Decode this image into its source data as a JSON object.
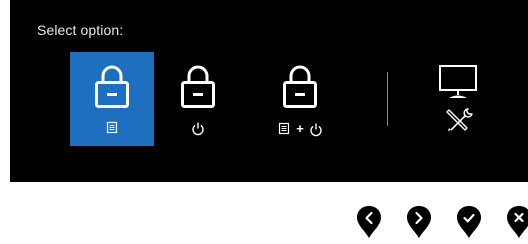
{
  "osd": {
    "prompt": "Select option:",
    "options": [
      {
        "id": "lock-menu",
        "icons": [
          "lock-icon",
          "menu-icon"
        ],
        "selected": true
      },
      {
        "id": "lock-power",
        "icons": [
          "lock-icon",
          "power-icon"
        ],
        "selected": false
      },
      {
        "id": "lock-menu-power",
        "icons": [
          "lock-icon",
          "menu-icon",
          "plus-icon",
          "power-icon"
        ],
        "plus_label": "+",
        "selected": false
      },
      {
        "id": "diagnostics",
        "icons": [
          "monitor-icon",
          "tools-icon"
        ],
        "selected": false
      }
    ]
  },
  "nav_buttons": [
    {
      "id": "previous",
      "icon": "chevron-left-icon"
    },
    {
      "id": "next",
      "icon": "chevron-right-icon"
    },
    {
      "id": "confirm",
      "icon": "checkmark-icon"
    },
    {
      "id": "exit",
      "icon": "close-icon"
    }
  ],
  "colors": {
    "panel_background": "#000000",
    "selected_highlight": "#1f6fc0",
    "icon": "#ffffff",
    "prompt_text": "#e6e6e6",
    "nav_button": "#000000"
  }
}
